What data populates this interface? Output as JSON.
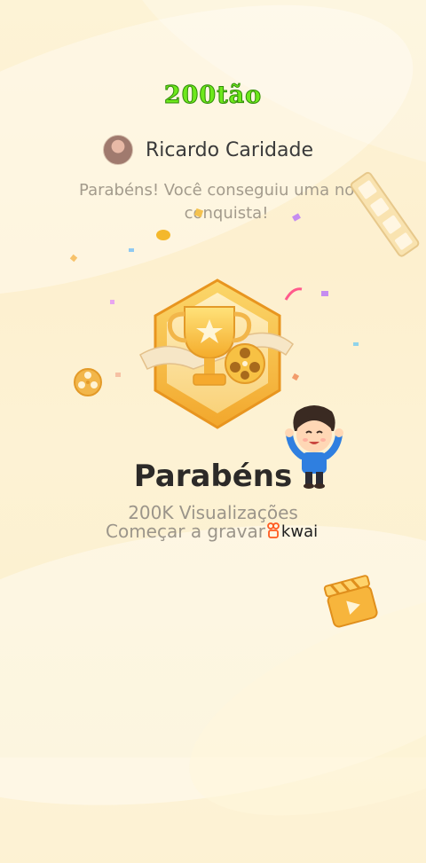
{
  "overlay": {
    "title": "200tão",
    "title_color": "#6ee81c"
  },
  "user": {
    "name": "Ricardo Caridade",
    "avatar_icon": "user-avatar"
  },
  "message": "Parabéns! Você conseguiu uma nova conquista!",
  "badge": {
    "icon": "trophy-film-badge-icon"
  },
  "main": {
    "title": "Parabéns",
    "views": "200K Visualizações",
    "record_label": "Começar a gravar",
    "brand": "kwai"
  },
  "colors": {
    "background": "#fdf3d6",
    "badge_gold": "#f6b93b",
    "accent_pink": "#ff5a8c"
  }
}
